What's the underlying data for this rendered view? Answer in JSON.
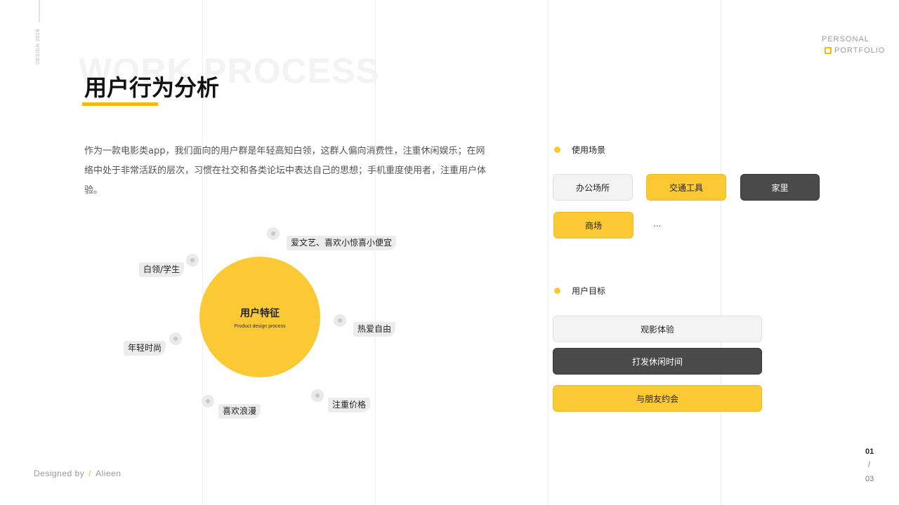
{
  "side": {
    "vertical_text": "DESIGN 2018"
  },
  "brand": {
    "line1": "PERSONAL",
    "line2": "PORTFOLIO"
  },
  "header": {
    "background_title": "WORK PROCESS",
    "title": "用户行为分析"
  },
  "description": "作为一款电影类app，我们面向的用户群是年轻高知白领，这群人偏向消费性，注重休闲娱乐；在网络中处于非常活跃的层次，习惯在社交和各类论坛中表达自己的思想；手机重度使用者，注重用户体验。",
  "diagram": {
    "center_title": "用户特征",
    "center_subtitle": "Product design process",
    "tags": [
      "爱文艺、喜欢小惊喜小便宜",
      "白领/学生",
      "热爱自由",
      "年轻时尚",
      "注重价格",
      "喜欢浪漫"
    ]
  },
  "scenes": {
    "label": "使用场景",
    "items": [
      "办公场所",
      "交通工具",
      "家里",
      "商场"
    ],
    "more": "..."
  },
  "goals": {
    "label": "用户目标",
    "items": [
      "观影体验",
      "打发休闲时间",
      "与朋友约会"
    ]
  },
  "footer": {
    "designed_by": "Designed by",
    "slash": "/",
    "author": "Alieen"
  },
  "pager": {
    "current": "01",
    "separator": "/",
    "total": "03"
  },
  "colors": {
    "accent": "#fbc933",
    "dark": "#4a4a4a",
    "light": "#f3f3f3"
  }
}
